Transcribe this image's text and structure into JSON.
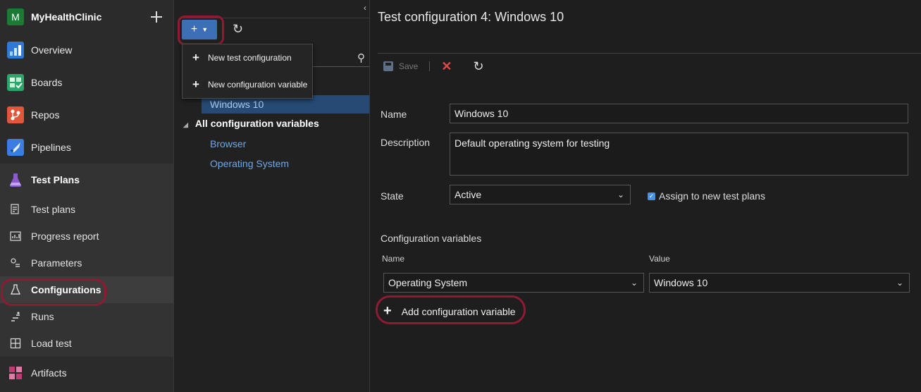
{
  "org": {
    "initial": "M",
    "name": "MyHealthClinic",
    "add_icon": "plus-icon"
  },
  "nav": {
    "main": [
      {
        "label": "Overview",
        "icon": "overview-icon",
        "color": "#2f7ad6"
      },
      {
        "label": "Boards",
        "icon": "boards-icon",
        "color": "#2aa76a"
      },
      {
        "label": "Repos",
        "icon": "repos-icon",
        "color": "#e0573a"
      },
      {
        "label": "Pipelines",
        "icon": "pipelines-icon",
        "color": "#3b7de0"
      },
      {
        "label": "Test Plans",
        "icon": "test-plans-icon",
        "color": "#8a5ad1"
      }
    ],
    "sub": [
      {
        "label": "Test plans",
        "icon": "test-plans-list-icon"
      },
      {
        "label": "Progress report",
        "icon": "progress-report-icon"
      },
      {
        "label": "Parameters",
        "icon": "parameters-icon"
      },
      {
        "label": "Configurations",
        "icon": "configurations-icon",
        "selected": true
      },
      {
        "label": "Runs",
        "icon": "runs-icon"
      },
      {
        "label": "Load test",
        "icon": "load-test-icon"
      }
    ],
    "artifacts": {
      "label": "Artifacts",
      "icon": "artifacts-icon",
      "color": "#c23b75"
    }
  },
  "middle": {
    "new_button": "+",
    "dropdown": [
      "New test configuration",
      "New configuration variable"
    ],
    "selected_config": "Windows 10",
    "variables_header": "All configuration variables",
    "variables": [
      "Browser",
      "Operating System"
    ]
  },
  "detail": {
    "title": "Test configuration 4: Windows 10",
    "toolbar": {
      "save": "Save"
    },
    "name_label": "Name",
    "name_value": "Windows 10",
    "description_label": "Description",
    "description_value": "Default operating system for testing",
    "state_label": "State",
    "state_value": "Active",
    "assign_label": "Assign to new test plans",
    "section_title": "Configuration variables",
    "col_name": "Name",
    "col_value": "Value",
    "var_name": "Operating System",
    "var_value": "Windows 10",
    "add_variable": "Add configuration variable"
  },
  "colors": {
    "accent": "#3d6fb6",
    "highlight_ring": "#8e1b33",
    "link": "#6fa8e8"
  }
}
